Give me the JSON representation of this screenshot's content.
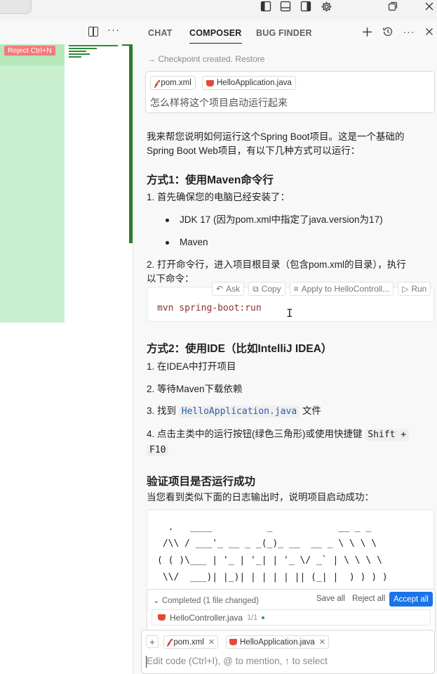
{
  "titlebar": {
    "icons": [
      "layout-sidebar-left-icon",
      "layout-panel-icon",
      "layout-sidebar-right-icon",
      "gear-icon",
      "restore-icon",
      "close-icon"
    ]
  },
  "editor": {
    "reject_badge": "Reject Ctrl+N"
  },
  "composer": {
    "tabs": [
      "CHAT",
      "COMPOSER",
      "BUG FINDER"
    ],
    "active_tab": "COMPOSER",
    "checkpoint_text": "→ Checkpoint created.",
    "restore_label": "Restore",
    "user_message": {
      "chips": [
        "pom.xml",
        "HelloApplication.java"
      ],
      "text": "怎么样将这个项目启动运行起来"
    },
    "response": {
      "intro_line1": "我来帮您说明如何运行这个Spring Boot项目。这是一个基础的",
      "intro_line2": "Spring Boot Web项目，有以下几种方式可以运行：",
      "method1_title": "方式1：使用Maven命令行",
      "step1": "1. 首先确保您的电脑已经安装了：",
      "bullets": [
        "JDK 17 (因为pom.xml中指定了java.version为17)",
        "Maven"
      ],
      "step2_line1": "2. 打开命令行，进入项目根目录（包含pom.xml的目录），执行",
      "step2_line2": "以下命令：",
      "code_actions": [
        "Ask",
        "Copy",
        "Apply to HelloControll...",
        "Run"
      ],
      "code": "mvn spring-boot:run",
      "method2_title": "方式2：使用IDE（比如IntelliJ IDEA）",
      "m2_step1": "1. 在IDEA中打开项目",
      "m2_step2": "2. 等待Maven下载依赖",
      "m2_step3_prefix": "3. 找到",
      "m2_step3_code": "HelloApplication.java",
      "m2_step3_suffix": "文件",
      "m2_step4_text": "4. 点击主类中的运行按钮(绿色三角形)或使用快捷键",
      "m2_step4_key1": "Shift +",
      "m2_step4_key2": "F10",
      "verify_title": "验证项目是否运行成功",
      "verify_text": "当您看到类似下面的日志输出时，说明项目启动成功：",
      "ascii_lines": [
        "  .   ____          _            __ _ _",
        " /\\\\ / ___'_ __ _ _(_)_ __  __ _ \\ \\ \\ \\",
        "( ( )\\___ | '_ | '_| | '_ \\/ _` | \\ \\ \\ \\",
        " \\\\/  ___)| |_)| | | | | || (_| |  ) ) ) )"
      ]
    },
    "completed": {
      "label": "Completed",
      "detail": "(1 file changed)",
      "save_all": "Save all",
      "reject_all": "Reject all",
      "accept_all": "Accept all",
      "file_name": "HelloController.java",
      "file_count": "1/1"
    },
    "input": {
      "chips": [
        "pom.xml",
        "HelloApplication.java"
      ],
      "placeholder": "Edit code (Ctrl+I), @ to mention, ↑ to select"
    }
  }
}
